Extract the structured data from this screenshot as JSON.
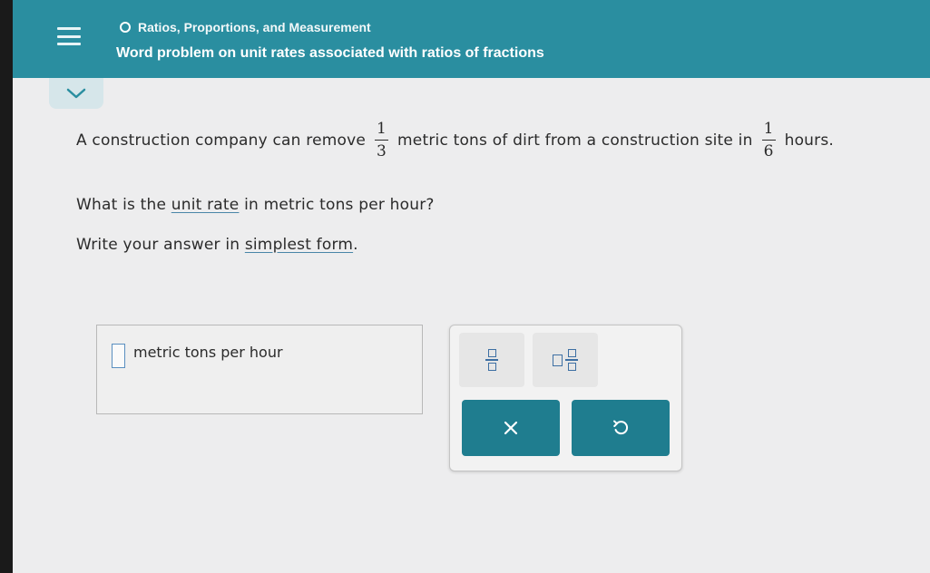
{
  "header": {
    "category": "Ratios, Proportions, and Measurement",
    "topic": "Word problem on unit rates associated with ratios of fractions"
  },
  "problem": {
    "sentence_part1": "A construction company can remove",
    "frac1": {
      "numerator": "1",
      "denominator": "3"
    },
    "sentence_part2": "metric tons of dirt from a construction site in",
    "frac2": {
      "numerator": "1",
      "denominator": "6"
    },
    "sentence_part3": "hours.",
    "question_before": "What is the",
    "question_link": "unit rate",
    "question_after": "in metric tons per hour?",
    "instruction_before": "Write your answer in",
    "instruction_link": "simplest form",
    "instruction_after": "."
  },
  "answer": {
    "value": "",
    "unit": "metric tons per hour"
  },
  "colors": {
    "header_bg": "#2a8ea0",
    "button_bg": "#1f7d8f",
    "page_bg": "#ededee"
  },
  "icons": [
    "menu-icon",
    "status-dot-icon",
    "chevron-down-icon",
    "fraction-icon",
    "mixed-number-icon",
    "close-icon",
    "undo-icon"
  ]
}
